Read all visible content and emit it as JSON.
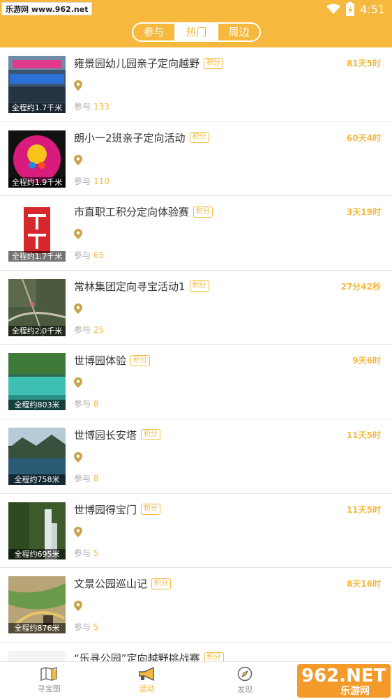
{
  "status_bar": {
    "watermark": "乐游网 www.962.net",
    "time": "4:51"
  },
  "tabs": [
    {
      "label": "参与",
      "active": false
    },
    {
      "label": "热门",
      "active": true
    },
    {
      "label": "周边",
      "active": false
    }
  ],
  "item_badge": "积分",
  "join_label": "参与",
  "items": [
    {
      "title": "雍景园幼儿园亲子定向越野",
      "time_left": "81天5时",
      "distance": "全程约1.7千米",
      "participants": "133"
    },
    {
      "title": "朗小一2班亲子定向活动",
      "time_left": "60天4时",
      "distance": "全程约1.9千米",
      "participants": "110"
    },
    {
      "title": "市直职工积分定向体验赛",
      "time_left": "3天19时",
      "distance": "全程约1.7千米",
      "participants": "65"
    },
    {
      "title": "常林集团定向寻宝活动1",
      "time_left": "27分42秒",
      "distance": "全程约2.0千米",
      "participants": "25"
    },
    {
      "title": "世博园体验",
      "time_left": "9天6时",
      "distance": "全程约803米",
      "participants": "8"
    },
    {
      "title": "世博园长安塔",
      "time_left": "11天5时",
      "distance": "全程约758米",
      "participants": "8"
    },
    {
      "title": "世博园得宝门",
      "time_left": "11天5时",
      "distance": "全程约695米",
      "participants": "5"
    },
    {
      "title": "文景公园巡山记",
      "time_left": "8天16时",
      "distance": "全程约876米",
      "participants": "5"
    },
    {
      "title": "“乐寻公园”定向越野挑战赛",
      "time_left": "",
      "distance": "",
      "participants": ""
    }
  ],
  "bottom_nav": [
    {
      "label": "寻宝图",
      "icon": "map-icon",
      "active": false
    },
    {
      "label": "活动",
      "icon": "megaphone-icon",
      "active": true
    },
    {
      "label": "发现",
      "icon": "compass-icon",
      "active": false
    }
  ],
  "corner_watermark": {
    "big": "962.NET",
    "small": "乐游网"
  },
  "colors": {
    "accent": "#f6b93d",
    "background": "#f2f2f2"
  }
}
